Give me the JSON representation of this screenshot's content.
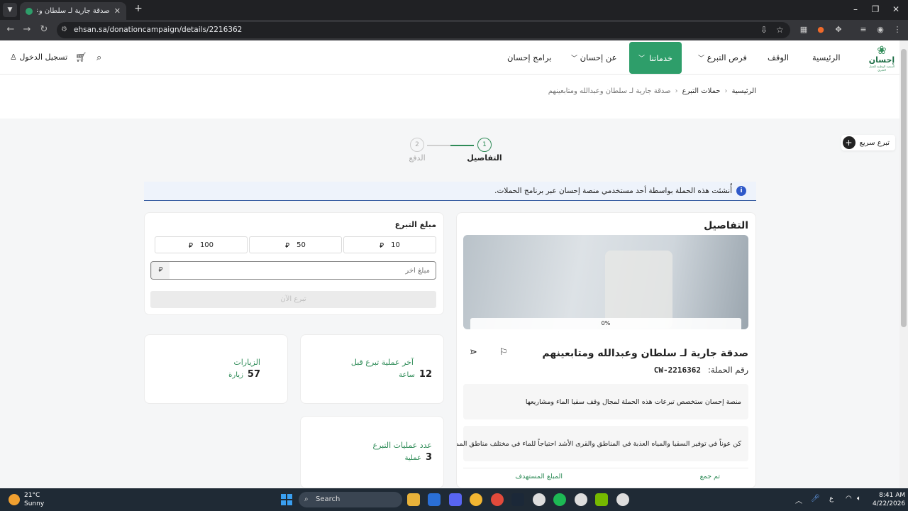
{
  "browser": {
    "tab_title": "صدقة جارية لـ سلطان وعبدالله و...",
    "url": "ehsan.sa/donationcampaign/details/2216362"
  },
  "header": {
    "logo": {
      "word": "إحسان",
      "sub": "المنصة الوطنية للعمل الخيري"
    },
    "nav": {
      "home": "الرئيسية",
      "waqf": "الوقف",
      "opportunities": "فرص التبرع",
      "services": "خدماتنا",
      "about": "عن إحسان",
      "programs": "برامج إحسان"
    },
    "login": "تسجيل الدخول"
  },
  "breadcrumb": {
    "home": "الرئيسية",
    "campaigns": "حملات التبرع",
    "current": "صدقة جارية لـ سلطان وعبدالله ومتابعينهم"
  },
  "quick_donate": "تبرع سريع",
  "stepper": {
    "step1": {
      "num": "1",
      "label": "التفاصيل"
    },
    "step2": {
      "num": "2",
      "label": "الدفع"
    }
  },
  "notice": {
    "icon_text": "i",
    "text": "أُنشئت هذه الحملة بواسطة أحد مستخدمي منصة إحسان عبر برنامج الحملات."
  },
  "amount": {
    "title": "مبلغ التبرع",
    "currency": "⃁",
    "options": [
      "10",
      "50",
      "100"
    ],
    "other_placeholder": "مبلغ آخر",
    "donate_label": "تبرع الآن"
  },
  "stats": {
    "last_donation": {
      "label": "آخر عملية تبرع قبل",
      "value": "12",
      "unit": "ساعة"
    },
    "visits": {
      "label": "الزيارات",
      "value": "57",
      "unit": "زيارة"
    },
    "donations_count": {
      "label": "عدد عمليات التبرع",
      "value": "3",
      "unit": "عملية"
    }
  },
  "details": {
    "title": "التفاصيل",
    "progress_percent": "0%",
    "progress_fraction": 0,
    "campaign_title": "صدقة جارية لـ سلطان وعبدالله ومتابعينهم",
    "campaign_number_label": "رقم الحملة:",
    "campaign_number": "CW-2216362",
    "info1": "منصة إحسان ستخصص تبرعات هذه الحملة لمجال وقف سقيا الماء ومشاريعها",
    "info2": "كن عوناً في توفير السقيا والمياه العذبة في المناطق والقرى الأشد احتياجاً للماء في مختلف مناطق المملكة",
    "collected_label": "تم جمع",
    "target_label": "المبلغ المستهدف"
  },
  "taskbar": {
    "temp": "21°C",
    "weather": "Sunny",
    "search": "Search",
    "time": "8:41 AM",
    "date": "4/22/2026",
    "lang": "ع"
  },
  "colors": {
    "brand_green": "#2e9e6a",
    "info_blue": "#2f59c9"
  }
}
